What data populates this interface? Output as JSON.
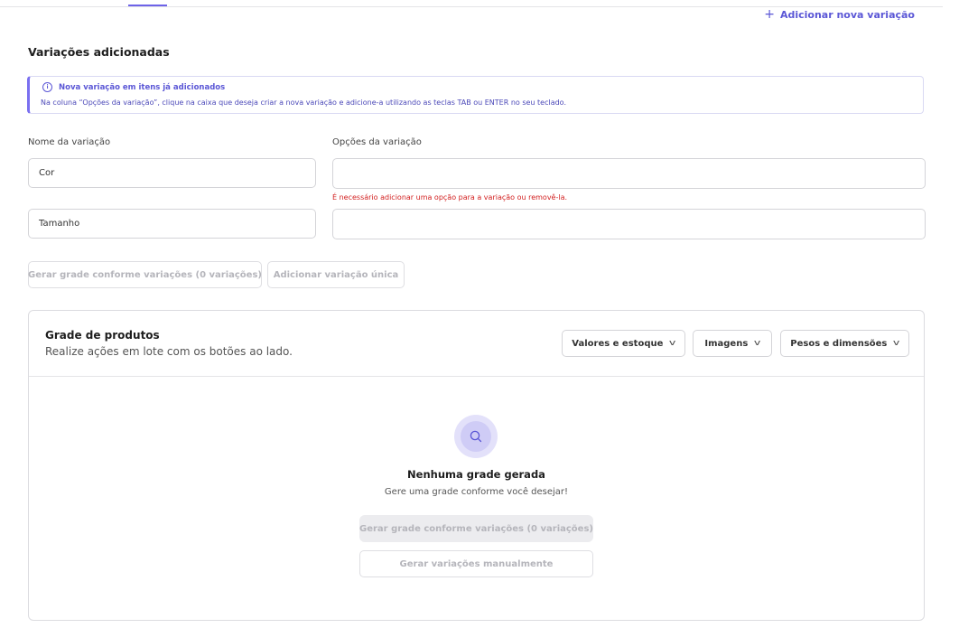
{
  "header": {
    "add_variation_label": "Adicionar nova variação"
  },
  "section": {
    "title": "Variações adicionadas"
  },
  "info": {
    "title": "Nova variação em itens já adicionados",
    "text": "Na coluna “Opções da variação”, clique na caixa que deseja criar a nova variação e adicione-a utilizando as teclas TAB ou ENTER no seu teclado."
  },
  "form": {
    "name_label": "Nome da variação",
    "options_label": "Opções da variação",
    "rows": [
      {
        "name": "Cor",
        "options": ""
      },
      {
        "name": "Tamanho",
        "options": ""
      }
    ],
    "error": "É necessário adicionar uma opção para a variação ou removê-la.",
    "generate_button": "Gerar grade conforme variações (0 variações)",
    "add_single_button": "Adicionar variação única"
  },
  "grid": {
    "title": "Grade de produtos",
    "subtitle": "Realize ações em lote com os botões ao lado.",
    "dropdowns": [
      "Valores e estoque",
      "Imagens",
      "Pesos e dimensões"
    ],
    "empty_title": "Nenhuma grade gerada",
    "empty_subtitle": "Gere uma grade conforme você desejar!",
    "generate_button": "Gerar grade conforme variações (0 variações)",
    "manual_button": "Gerar variações manualmente"
  },
  "colors": {
    "accent": "#5b57d6",
    "error": "#d21f1f"
  },
  "icons": {
    "plus": "plus-icon",
    "info": "info-icon",
    "search": "search-icon",
    "chevron": "chevron-down-icon"
  }
}
